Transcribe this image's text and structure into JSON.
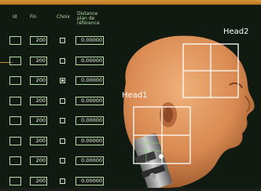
{
  "table": {
    "headers": {
      "col1": "Id",
      "col2": "Fin",
      "col3": "Choix",
      "col4": "Distance plan de référence"
    },
    "rows": [
      {
        "fin": "200",
        "checked": false,
        "distance": "0.00000"
      },
      {
        "fin": "200",
        "checked": false,
        "distance": "0.00000"
      },
      {
        "fin": "200",
        "checked": true,
        "distance": "0.00000"
      },
      {
        "fin": "200",
        "checked": false,
        "distance": "0.00000"
      },
      {
        "fin": "200",
        "checked": false,
        "distance": "0.00000"
      },
      {
        "fin": "200",
        "checked": false,
        "distance": "0.00000"
      },
      {
        "fin": "200",
        "checked": false,
        "distance": "0.00000"
      },
      {
        "fin": "200",
        "checked": false,
        "distance": "0.00000"
      }
    ]
  },
  "viewport": {
    "head1_label": "Head1",
    "head2_label": "Head2"
  },
  "colors": {
    "accent": "#d99640",
    "panel_text": "#b9dcae",
    "skin": "#d98a52",
    "grid": "#ffffff"
  }
}
